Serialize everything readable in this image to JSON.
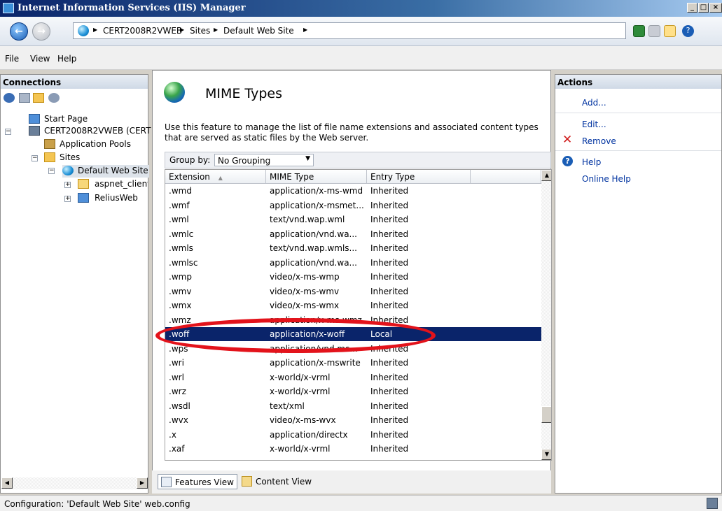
{
  "window": {
    "title": "Internet Information Services (IIS) Manager",
    "min": "_",
    "max": "□",
    "close": "×"
  },
  "breadcrumb": {
    "items": [
      "CERT2008R2VWEB",
      "Sites",
      "Default Web Site"
    ]
  },
  "menu": {
    "file": "File",
    "view": "View",
    "help": "Help"
  },
  "connections": {
    "title": "Connections",
    "tree": {
      "start_page": "Start Page",
      "server": "CERT2008R2VWEB (CERT",
      "app_pools": "Application Pools",
      "sites": "Sites",
      "default_site": "Default Web Site",
      "aspnet_client": "aspnet_client",
      "relius": "ReliusWeb"
    }
  },
  "main": {
    "title": "MIME Types",
    "description": "Use this feature to manage the list of file name extensions and associated content types that are served as static files by the Web server.",
    "group_by_label": "Group by:",
    "group_by_value": "No Grouping",
    "columns": {
      "extension": "Extension",
      "mime": "MIME Type",
      "entry": "Entry Type"
    },
    "rows": [
      {
        "ext": ".wmd",
        "mime": "application/x-ms-wmd",
        "entry": "Inherited"
      },
      {
        "ext": ".wmf",
        "mime": "application/x-msmet...",
        "entry": "Inherited"
      },
      {
        "ext": ".wml",
        "mime": "text/vnd.wap.wml",
        "entry": "Inherited"
      },
      {
        "ext": ".wmlc",
        "mime": "application/vnd.wa...",
        "entry": "Inherited"
      },
      {
        "ext": ".wmls",
        "mime": "text/vnd.wap.wmls...",
        "entry": "Inherited"
      },
      {
        "ext": ".wmlsc",
        "mime": "application/vnd.wa...",
        "entry": "Inherited"
      },
      {
        "ext": ".wmp",
        "mime": "video/x-ms-wmp",
        "entry": "Inherited"
      },
      {
        "ext": ".wmv",
        "mime": "video/x-ms-wmv",
        "entry": "Inherited"
      },
      {
        "ext": ".wmx",
        "mime": "video/x-ms-wmx",
        "entry": "Inherited"
      },
      {
        "ext": ".wmz",
        "mime": "application/x-ms-wmz",
        "entry": "Inherited"
      },
      {
        "ext": ".woff",
        "mime": "application/x-woff",
        "entry": "Local"
      },
      {
        "ext": ".wps",
        "mime": "application/vnd.ms...",
        "entry": "Inherited"
      },
      {
        "ext": ".wri",
        "mime": "application/x-mswrite",
        "entry": "Inherited"
      },
      {
        "ext": ".wrl",
        "mime": "x-world/x-vrml",
        "entry": "Inherited"
      },
      {
        "ext": ".wrz",
        "mime": "x-world/x-vrml",
        "entry": "Inherited"
      },
      {
        "ext": ".wsdl",
        "mime": "text/xml",
        "entry": "Inherited"
      },
      {
        "ext": ".wvx",
        "mime": "video/x-ms-wvx",
        "entry": "Inherited"
      },
      {
        "ext": ".x",
        "mime": "application/directx",
        "entry": "Inherited"
      },
      {
        "ext": ".xaf",
        "mime": "x-world/x-vrml",
        "entry": "Inherited"
      }
    ],
    "selected_row": 10,
    "features_view": "Features View",
    "content_view": "Content View"
  },
  "actions": {
    "title": "Actions",
    "add": "Add...",
    "edit": "Edit...",
    "remove": "Remove",
    "help": "Help",
    "online_help": "Online Help"
  },
  "status": {
    "text": "Configuration: 'Default Web Site' web.config"
  },
  "colors": {
    "selection": "#0a246a",
    "highlight_circle": "#e3131b",
    "link": "#0033a0"
  },
  "icons": [
    "app-icon",
    "back-icon",
    "forward-icon",
    "globe-icon",
    "refresh-icon",
    "stop-icon",
    "home-icon",
    "help-icon",
    "connect-icon",
    "save-icon",
    "folder-icon",
    "disconnect-icon",
    "server-icon",
    "app-pool-icon",
    "sites-icon",
    "website-icon",
    "remove-icon",
    "features-view-icon",
    "content-view-icon",
    "network-icon"
  ]
}
